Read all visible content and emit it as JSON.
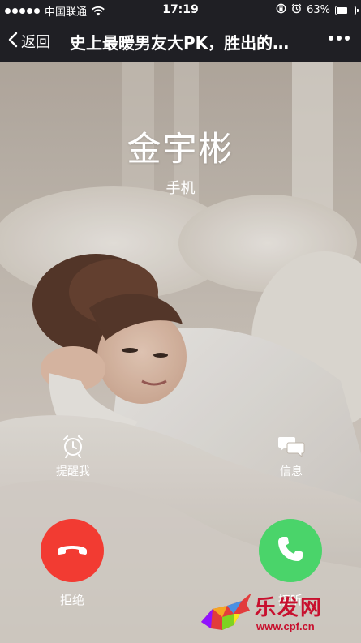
{
  "statusbar": {
    "carrier": "中国联通",
    "time": "17:19",
    "battery_text": "63%",
    "battery_level": 0.63
  },
  "navbar": {
    "back_label": "返回",
    "title": "史上最暖男友大PK，胜出的…"
  },
  "call": {
    "caller_name": "金宇彬",
    "caller_type": "手机",
    "remind_label": "提醒我",
    "message_label": "信息",
    "decline_label": "拒绝",
    "accept_label": "接听",
    "decline_color": "#f23b32",
    "accept_color": "#4ad46a"
  },
  "watermark": {
    "brand": "乐发网",
    "url": "www.cpf.cn"
  },
  "icons": {
    "back": "chevron-left-icon",
    "more": "more-dots-icon",
    "remind": "alarm-clock-icon",
    "message": "chat-bubbles-icon",
    "decline": "phone-hangup-icon",
    "accept": "phone-icon"
  }
}
